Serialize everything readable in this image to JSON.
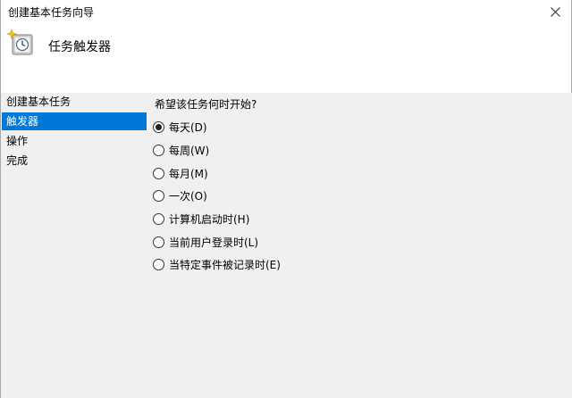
{
  "window": {
    "title": "创建基本任务向导",
    "close_glyph": "✕"
  },
  "header": {
    "icon": "task-scheduler-clock-icon",
    "title": "任务触发器"
  },
  "sidebar": {
    "items": [
      {
        "label": "创建基本任务",
        "selected": false
      },
      {
        "label": "触发器",
        "selected": true
      },
      {
        "label": "操作",
        "selected": false
      },
      {
        "label": "完成",
        "selected": false
      }
    ]
  },
  "content": {
    "question": "希望该任务何时开始?",
    "options": [
      {
        "label": "每天(D)",
        "checked": true
      },
      {
        "label": "每周(W)",
        "checked": false
      },
      {
        "label": "每月(M)",
        "checked": false
      },
      {
        "label": "一次(O)",
        "checked": false
      },
      {
        "label": "计算机启动时(H)",
        "checked": false
      },
      {
        "label": "当前用户登录时(L)",
        "checked": false
      },
      {
        "label": "当特定事件被记录时(E)",
        "checked": false
      }
    ]
  },
  "colors": {
    "selection": "#0078d7",
    "panel": "#f0f0f0",
    "header_bg": "#ffffff"
  }
}
